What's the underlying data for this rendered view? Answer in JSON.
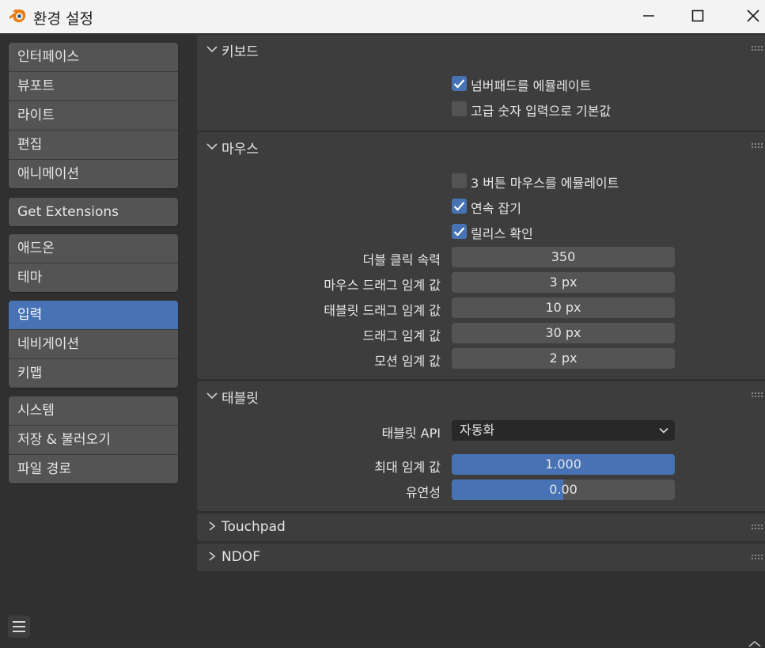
{
  "window": {
    "title": "환경 설정",
    "icon": "blender-logo-icon",
    "controls": [
      "minimize-icon",
      "maximize-icon",
      "close-icon"
    ]
  },
  "sidebar": {
    "groups": [
      {
        "items": [
          {
            "label": "인터페이스"
          },
          {
            "label": "뷰포트"
          },
          {
            "label": "라이트"
          },
          {
            "label": "편집"
          },
          {
            "label": "애니메이션"
          }
        ]
      },
      {
        "items": [
          {
            "label": "Get Extensions"
          }
        ]
      },
      {
        "items": [
          {
            "label": "애드온"
          },
          {
            "label": "테마"
          }
        ]
      },
      {
        "items": [
          {
            "label": "입력",
            "active": true
          },
          {
            "label": "네비게이션"
          },
          {
            "label": "키맵"
          }
        ]
      },
      {
        "items": [
          {
            "label": "시스템"
          },
          {
            "label": "저장 & 불러오기"
          },
          {
            "label": "파일 경로"
          }
        ]
      }
    ],
    "menu_icon": "hamburger-menu-icon"
  },
  "keyboard": {
    "title": "키보드",
    "expanded": true,
    "emulate_numpad": {
      "label": "넘버패드를 에뮬레이트",
      "checked": true
    },
    "default_advanced_numeric": {
      "label": "고급 숫자 입력으로 기본값",
      "checked": false
    }
  },
  "mouse": {
    "title": "마우스",
    "expanded": true,
    "emulate_3_button": {
      "label": "3 버튼 마우스를 에뮬레이트",
      "checked": false
    },
    "continuous_grab": {
      "label": "연속 잡기",
      "checked": true
    },
    "release_confirms": {
      "label": "릴리스 확인",
      "checked": true
    },
    "double_click_speed": {
      "label": "더블 클릭 속력",
      "value": "350"
    },
    "mouse_drag_threshold": {
      "label": "마우스 드래그 임계 값",
      "value": "3 px"
    },
    "tablet_drag_threshold": {
      "label": "태블릿 드래그 임계 값",
      "value": "10 px"
    },
    "drag_threshold": {
      "label": "드래그 임계 값",
      "value": "30 px"
    },
    "motion_threshold": {
      "label": "모션 임계 값",
      "value": "2 px"
    }
  },
  "tablet": {
    "title": "태블릿",
    "expanded": true,
    "api": {
      "label": "태블릿 API",
      "value": "자동화"
    },
    "max_threshold": {
      "label": "최대 임계 값",
      "value": "1.000",
      "fraction": 1.0
    },
    "softness": {
      "label": "유연성",
      "value": "0.00",
      "fraction": 0.5
    }
  },
  "touchpad": {
    "title": "Touchpad",
    "expanded": false
  },
  "ndof": {
    "title": "NDOF",
    "expanded": false
  },
  "colors": {
    "accent": "#4772b3",
    "background": "#303030",
    "panel": "#3d3d3d",
    "widget": "#545454"
  }
}
